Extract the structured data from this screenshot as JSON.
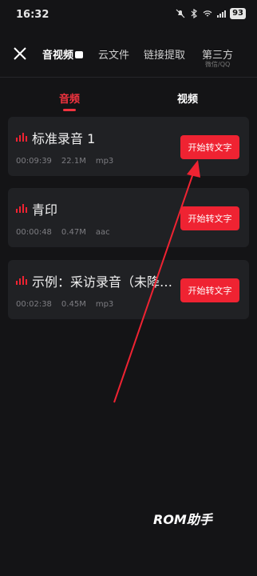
{
  "status_bar": {
    "time": "16:32",
    "battery": "93"
  },
  "nav": {
    "tabs": [
      {
        "label": "音视频"
      },
      {
        "label": "云文件"
      },
      {
        "label": "链接提取"
      },
      {
        "label": "第三方",
        "sub": "微信/QQ"
      }
    ]
  },
  "segment": {
    "audio": "音频",
    "video": "视频"
  },
  "files": [
    {
      "name": "标准录音 1",
      "duration": "00:09:39",
      "size": "22.1M",
      "format": "mp3",
      "button": "开始转文字"
    },
    {
      "name": "青印",
      "duration": "00:00:48",
      "size": "0.47M",
      "format": "aac",
      "button": "开始转文字"
    },
    {
      "name": "示例：采访录音（未降…",
      "duration": "00:02:38",
      "size": "0.45M",
      "format": "mp3",
      "button": "开始转文字"
    }
  ],
  "watermark": "ROM助手",
  "colors": {
    "accent": "#ef2332",
    "background": "#141416",
    "card": "#202124"
  }
}
